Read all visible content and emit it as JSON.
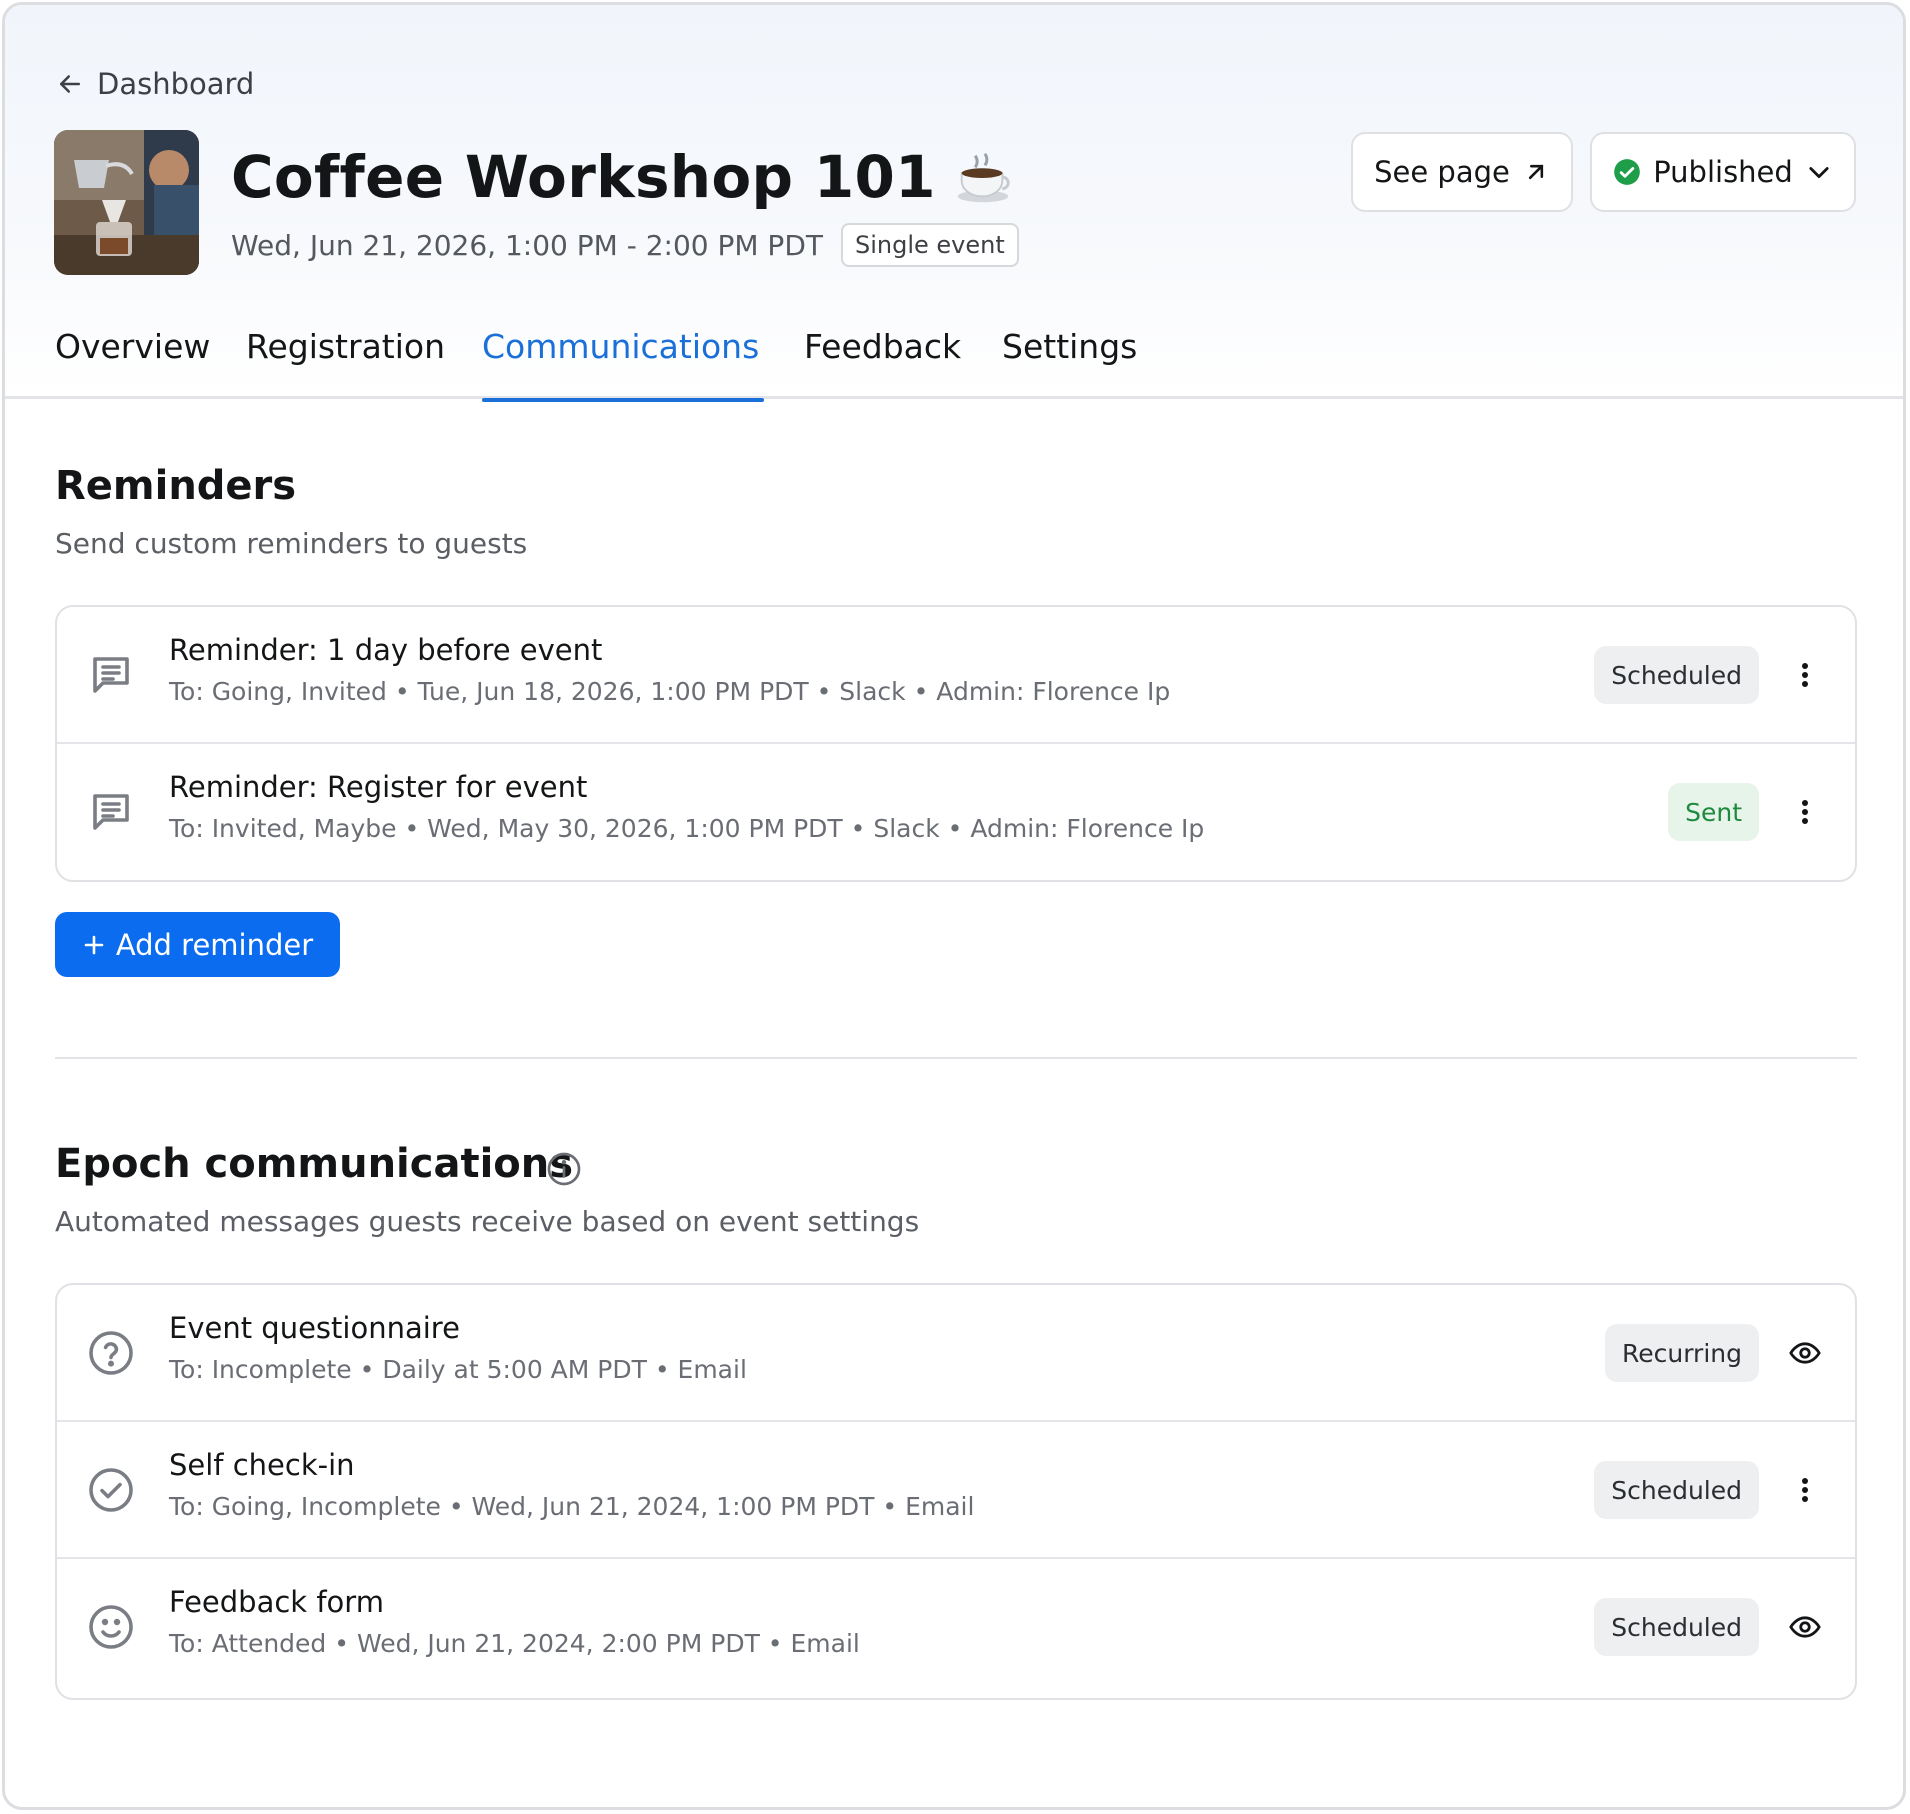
{
  "nav": {
    "back_label": "Dashboard"
  },
  "event": {
    "title": "Coffee Workshop 101",
    "date": "Wed, Jun 21, 2026, 1:00 PM - 2:00 PM PDT",
    "type_badge": "Single event"
  },
  "actions": {
    "see_page_label": "See page",
    "status_label": "Published",
    "status_color": "#1f9e4a"
  },
  "tabs": [
    {
      "label": "Overview"
    },
    {
      "label": "Registration"
    },
    {
      "label": "Communications"
    },
    {
      "label": "Feedback"
    },
    {
      "label": "Settings"
    }
  ],
  "reminders": {
    "title": "Reminders",
    "subtitle": "Send custom reminders to guests",
    "items": [
      {
        "icon": "message-icon",
        "title": "Reminder: 1 day before event",
        "meta": "To: Going, Invited • Tue, Jun 18, 2026, 1:00 PM PDT • Slack • Admin: Florence Ip",
        "status": "Scheduled",
        "action": "more-icon"
      },
      {
        "icon": "message-icon",
        "title": "Reminder: Register for event",
        "meta": "To: Invited, Maybe • Wed, May 30, 2026, 1:00 PM PDT • Slack • Admin: Florence Ip",
        "status": "Sent",
        "action": "more-icon"
      }
    ],
    "add_label": "Add reminder"
  },
  "epoch": {
    "title": "Epoch communications",
    "subtitle": "Automated messages guests receive based on event settings",
    "items": [
      {
        "icon": "question-icon",
        "title": "Event questionnaire",
        "meta": "To: Incomplete • Daily at 5:00 AM PDT • Email",
        "status": "Recurring",
        "action": "eye-icon"
      },
      {
        "icon": "check-circle-icon",
        "title": "Self check-in",
        "meta": "To: Going, Incomplete • Wed, Jun 21, 2024, 1:00 PM PDT • Email",
        "status": "Scheduled",
        "action": "more-icon"
      },
      {
        "icon": "smile-icon",
        "title": "Feedback form",
        "meta": "To: Attended • Wed, Jun 21, 2024, 2:00 PM PDT • Email",
        "status": "Scheduled",
        "action": "eye-icon"
      }
    ]
  },
  "colors": {
    "accent": "#1a6fd8",
    "primary_button": "#0b6cf0"
  }
}
